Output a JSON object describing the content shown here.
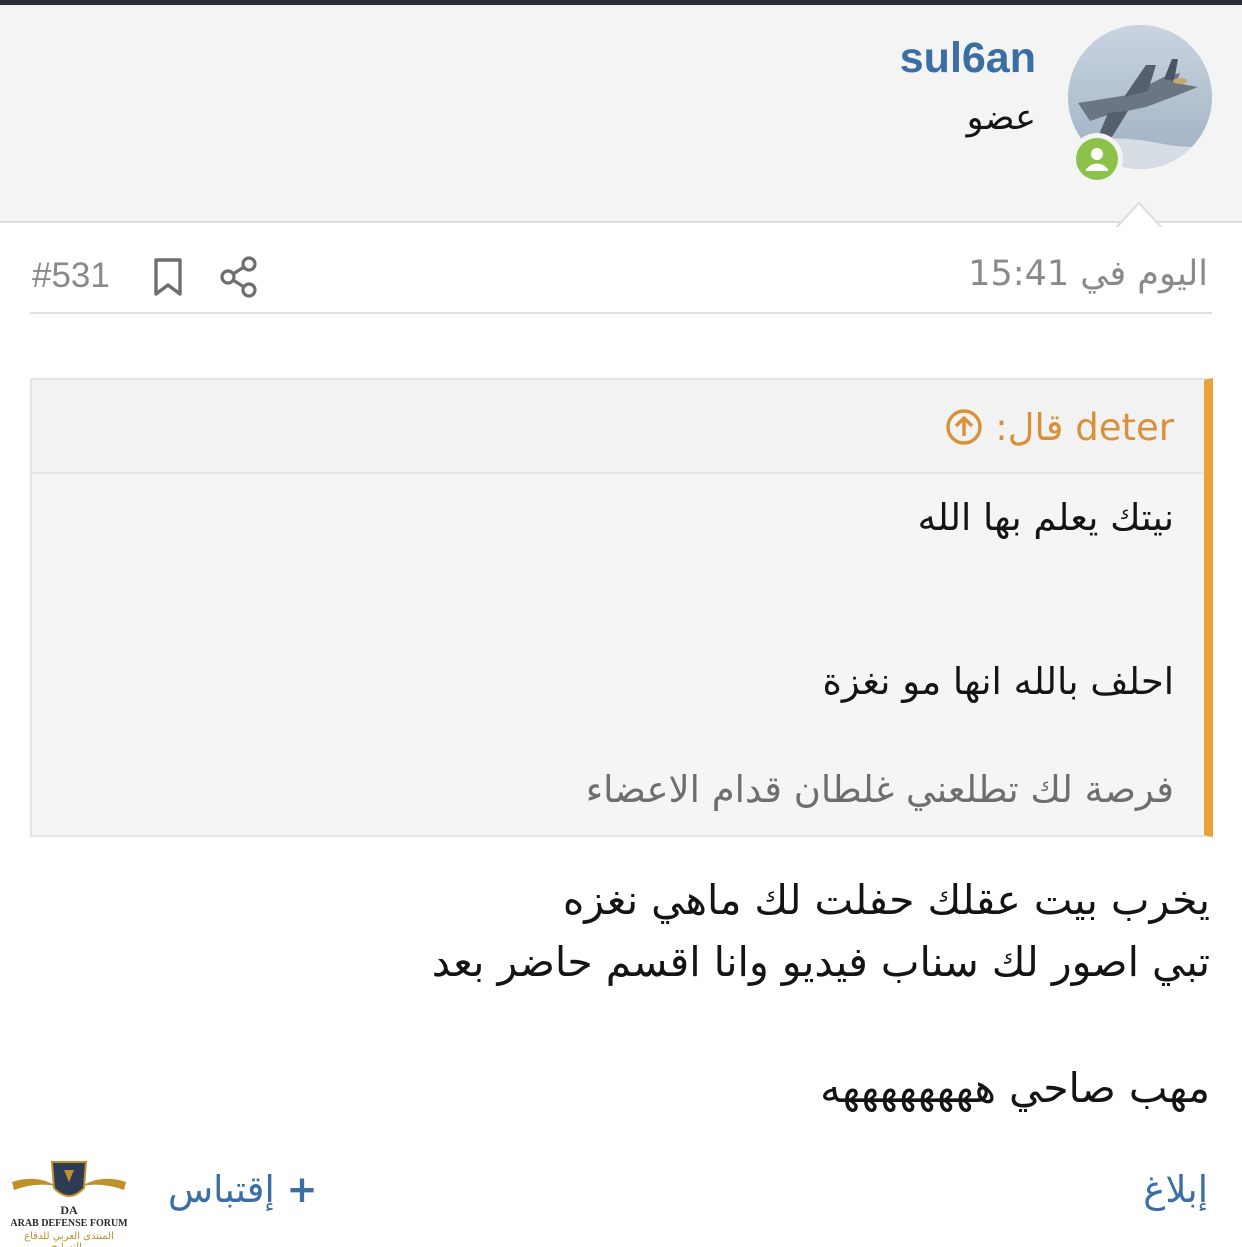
{
  "user": {
    "username": "sul6an",
    "title": "عضو",
    "online": true
  },
  "post": {
    "date": "اليوم في 15:41",
    "number": "#531"
  },
  "quote": {
    "author": "deter قال:",
    "lines": [
      "نيتك يعلم بها الله",
      "احلف بالله انها مو نغزة",
      "فرصة لك تطلعني غلطان قدام الاعضاء"
    ]
  },
  "message": {
    "lines": [
      "يخرب بيت عقلك حفلت لك ماهي نغزه",
      "تبي اصور لك سناب فيديو وانا اقسم حاضر بعد",
      "مهب صاحي ههههههههه"
    ]
  },
  "actions": {
    "report": "إبلاغ",
    "quote_plus": "+",
    "quote_label": "إقتباس"
  },
  "watermark": {
    "letters": "DA",
    "english": "ARAB DEFENSE FORUM",
    "arabic": "المنتدى العربي للدفاع والتسليح"
  },
  "colors": {
    "accent_blue": "#3b6ea5",
    "quote_orange": "#e8a13c",
    "online_green": "#8bc34a",
    "muted_gray": "#8a8a8a"
  },
  "icons": [
    "share-icon",
    "bookmark-icon",
    "arrow-up-circle-icon",
    "online-status-icon"
  ]
}
